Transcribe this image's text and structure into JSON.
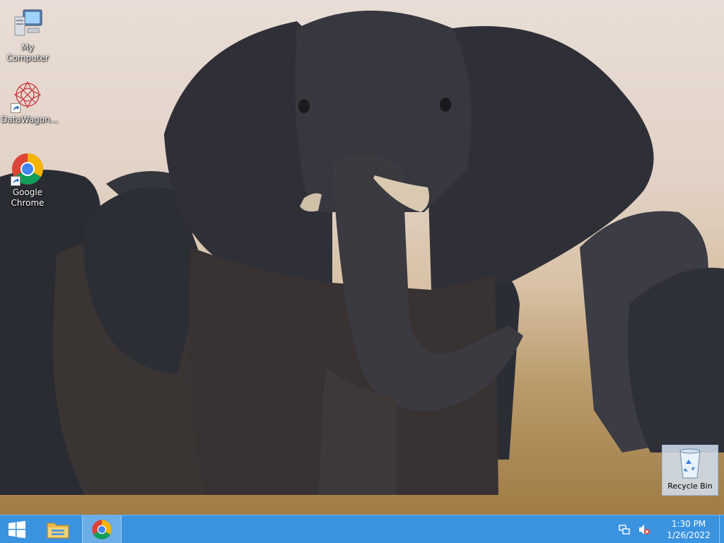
{
  "desktop": {
    "icons": [
      {
        "label": "My Computer",
        "icon": "computer-icon"
      },
      {
        "label": "DataWagon...",
        "icon": "datawagon-icon"
      },
      {
        "label": "Google\nChrome",
        "label_line1": "Google",
        "label_line2": "Chrome",
        "icon": "chrome-icon"
      }
    ],
    "recycle_bin": {
      "label": "Recycle Bin",
      "icon": "recycle-bin-icon"
    }
  },
  "taskbar": {
    "start": {
      "icon": "windows-logo-icon"
    },
    "pinned": [
      {
        "name": "File Explorer",
        "icon": "folder-icon"
      },
      {
        "name": "Google Chrome",
        "icon": "chrome-icon",
        "active": true
      }
    ],
    "tray": {
      "network_icon": "network-icon",
      "volume_icon": "volume-muted-icon",
      "time": "1:30 PM",
      "date": "1/26/2022"
    }
  },
  "colors": {
    "taskbar": "#3b93e0",
    "chrome_red": "#db4437",
    "chrome_green": "#0f9d58",
    "chrome_yellow": "#f4b400",
    "chrome_blue": "#4285f4"
  }
}
